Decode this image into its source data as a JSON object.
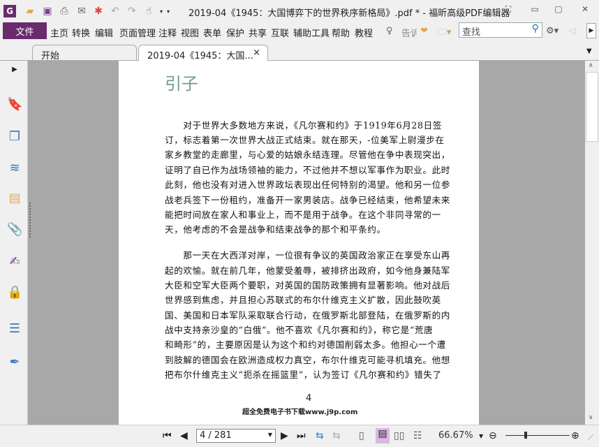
{
  "titlebar": {
    "title": "2019-04《1945：大国博弈下的世界秩序新格局》.pdf * - 福昕高级PDF编辑器",
    "quick_access": [
      "app-logo",
      "open-folder",
      "save",
      "print",
      "email",
      "new",
      "undo",
      "redo",
      "hand-tool",
      "dropdown"
    ]
  },
  "menu": {
    "file": "文件",
    "items": [
      "主页",
      "转换",
      "编辑",
      "页面管理",
      "注释",
      "视图",
      "表单",
      "保护",
      "共享",
      "互联",
      "辅助工具",
      "帮助",
      "教程"
    ],
    "tell_me": "告诉",
    "search_placeholder": "查找"
  },
  "tabs": [
    {
      "label": "开始"
    },
    {
      "label": "2019-04《1945：大国...",
      "close": "×"
    }
  ],
  "document": {
    "heading": "引子",
    "lines": [
      "　　对于世界大多数地方来说，《凡尔赛和约》于1919年6月28日签",
      "订，标志着第一次世界大战正式结束。就在那天，-位美军上尉漫步在",
      "家乡教堂的走廊里，与心爱的姑娘永结连理。尽管他在争中表现突出，",
      "证明了自已作为战场领袖的能力，不过他并不想以军事作为职业。此时",
      "此刻，他也没有对进入世界政坛表现出任何特别的渴望。他和另一位参",
      "战老兵签下一份租约，准备开一家男装店。战争已经结束，他希望未来",
      "能把时间放在家人和事业上，而不是用于战争。在这个非同寻常的一",
      "天，他考虑的不会是战争和结束战争的那个和平条约。",
      "　　那一天在大西洋对岸，一位很有争议的英国政治家正在享受东山再",
      "起的欢愉。就在前几年，他蒙受羞辱，被排挤出政府，如今他身兼陆军",
      "大臣和空军大臣两个要职，对英国的国防政策拥有显著影响。他对战后",
      "世界感到焦虑，并且担心苏联式的布尔什维克主义扩散，因此鼓吹英",
      "国、美国和日本军队采取联合行动，在俄罗斯北部登陆，在俄罗斯的内",
      "战中支持亲沙皇的“白俄”。他不喜欢《凡尔赛和约》，称它是“荒唐",
      "和畸形”的，主要原因是认为这个和约对德国削弱太多。他担心一个遭",
      "到肢解的德国会在欧洲造成权力真空，布尔什维克可能寻机填充。他想",
      "把布尔什维克主义“扼杀在摇篮里”，认为签订《凡尔赛和约》错失了"
    ],
    "page_number": "4",
    "footer": "超全免费电子书下载www.j9p.com"
  },
  "status": {
    "page_field": "4 / 281",
    "zoom": "66.67%"
  },
  "colors": {
    "accent": "#6a2a6e",
    "heading": "#6e9e8c"
  }
}
